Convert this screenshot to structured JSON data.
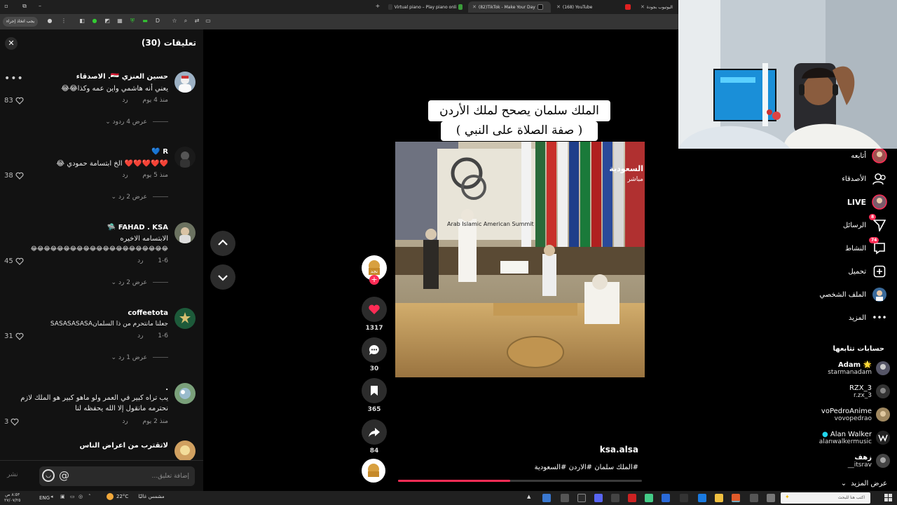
{
  "browser": {
    "tabs": [
      {
        "title": "Virtual piano – Play piano onli",
        "active": false
      },
      {
        "title": "(82)TikTok - Make Your Day",
        "active": true
      },
      {
        "title": "(168) YouTube",
        "active": false
      },
      {
        "title": "اليوتيوب بجودة",
        "active": false
      }
    ],
    "toolbar_button": "يجب اتخاذ إجراء"
  },
  "comments_panel": {
    "title": "تعليقات (30)",
    "input_placeholder": "إضافة تعليق...",
    "post_label": "نشر",
    "comments": [
      {
        "user": "حسين العنزي 🇮🇶. الاصدقاء",
        "text": "يعني أنه هاشمي واين عمه وكذا😂😂",
        "time": "منذ 4 يوم",
        "reply": "رد",
        "likes": "83",
        "more": "عرض 4 ردود"
      },
      {
        "user": "R 💙",
        "text": "❤️❤️❤️❤️❤️ الخ ابتسامة حمودي 😂",
        "time": "منذ 5 يوم",
        "reply": "رد",
        "likes": "38",
        "more": "عرض 2 رد"
      },
      {
        "user": "FAHAD . KSA 🛸",
        "text": "الابتسامه الاخيره",
        "text2": "😂😂😂😂😂😂😂😂😂😂😂😂😂😂😂😂😂😂😂😂😂",
        "time": "1-6",
        "reply": "رد",
        "likes": "45",
        "more": "عرض 2 رد"
      },
      {
        "user": "coffeetota",
        "text": "جعلنا مانتحرم من ذا السلمانSASASASASA",
        "time": "1-6",
        "reply": "رد",
        "likes": "31",
        "more": "عرض 1 رد"
      },
      {
        "user": ".",
        "text": "يب تراه كبير في العمر ولو ماهو كبير هو الملك لازم نحترمه مانقول إلا الله يحفظه لنا",
        "time": "منذ 2 يوم",
        "reply": "رد",
        "likes": "3"
      },
      {
        "user": "لاتقترب من اعراض الناس",
        "text": ""
      }
    ]
  },
  "video": {
    "caption_line1": "الملك سلمان يصحح لملك الأردن",
    "caption_line2": "( صفة الصلاة على النبي )",
    "author": "ksa.alsa",
    "description": "#الملك سلمان #الاردن #السعودية",
    "progress": 0.46,
    "likes": "1317",
    "comments": "30",
    "saves": "365",
    "shares": "84",
    "summit_text": "Arab Islamic American Summit",
    "channel_text": "السعودية",
    "channel_sub": "مباشر"
  },
  "sidebar": {
    "nav": [
      {
        "label": "أتابعه",
        "icon": "following-avatar-icon"
      },
      {
        "label": "الأصدقاء",
        "icon": "friends-icon"
      },
      {
        "label": "LIVE",
        "icon": "live-icon"
      },
      {
        "label": "الرسائل",
        "icon": "messages-icon",
        "badge": "8"
      },
      {
        "label": "النشاط",
        "icon": "activity-icon",
        "badge": "74"
      },
      {
        "label": "تحميل",
        "icon": "upload-icon"
      },
      {
        "label": "الملف الشخصي",
        "icon": "profile-icon"
      },
      {
        "label": "المزيد",
        "icon": "more-icon"
      }
    ],
    "following_title": "حسابات تتابعها",
    "accounts": [
      {
        "name": "Adam 🌟",
        "handle": "starmanadam"
      },
      {
        "name": "RZX_3",
        "handle": "r.zx_3"
      },
      {
        "name": "voPedroAnime",
        "handle": "vovopedrao"
      },
      {
        "name": "Alan Walker",
        "handle": "alanwalkermusic"
      },
      {
        "name": "زهف",
        "handle": "__itsrav"
      }
    ],
    "see_more": "عرض المزيد"
  },
  "taskbar": {
    "weather": "22°C",
    "weather_desc": "مشمس غالبًا",
    "lang": "ENG",
    "time": "٨:٥٣ ص",
    "date": "٢٧/٠٧/٢٥",
    "search_placeholder": "اكتب هنا للبحث"
  },
  "colors": {
    "accent": "#fe2c55",
    "panel": "#121212",
    "tab_active": "#353535"
  }
}
